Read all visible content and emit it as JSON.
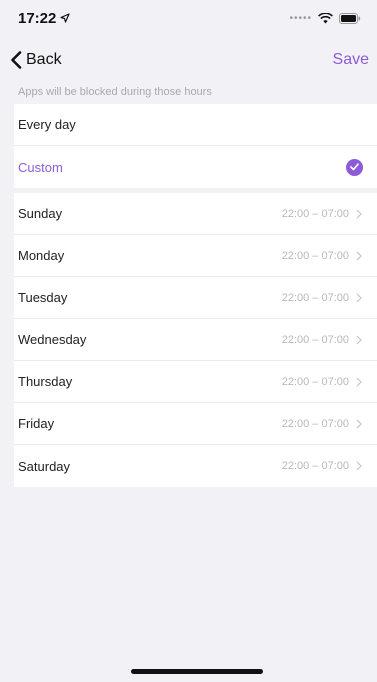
{
  "status_bar": {
    "time": "17:22"
  },
  "nav": {
    "back_label": "Back",
    "save_label": "Save"
  },
  "caption": "Apps will be blocked during those hours",
  "mode_options": [
    {
      "label": "Every day",
      "selected": false
    },
    {
      "label": "Custom",
      "selected": true
    }
  ],
  "days": [
    {
      "day": "Sunday",
      "time": "22:00 – 07:00"
    },
    {
      "day": "Monday",
      "time": "22:00 – 07:00"
    },
    {
      "day": "Tuesday",
      "time": "22:00 – 07:00"
    },
    {
      "day": "Wednesday",
      "time": "22:00 – 07:00"
    },
    {
      "day": "Thursday",
      "time": "22:00 – 07:00"
    },
    {
      "day": "Friday",
      "time": "22:00 – 07:00"
    },
    {
      "day": "Saturday",
      "time": "22:00 – 07:00"
    }
  ],
  "colors": {
    "accent": "#8e5bd8",
    "background": "#f2f2f6"
  },
  "icons": [
    "location-arrow-icon",
    "cellular-dots-icon",
    "wifi-icon",
    "battery-icon",
    "chevron-left-icon",
    "checkmark-circle-icon",
    "chevron-right-icon"
  ]
}
